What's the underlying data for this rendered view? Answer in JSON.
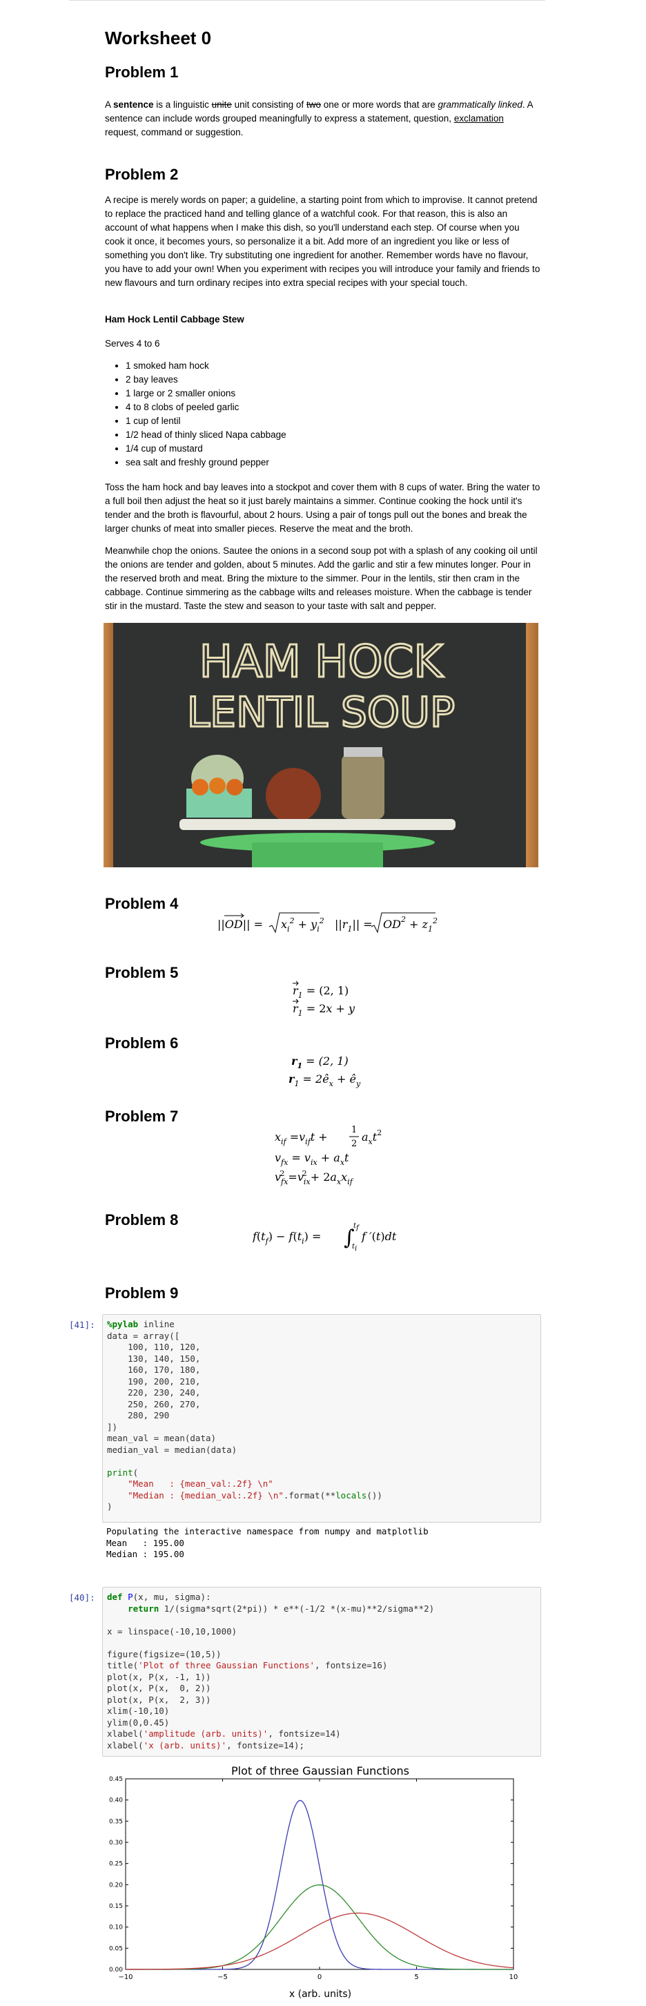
{
  "title": "Worksheet 0",
  "problem1": {
    "heading": "Problem 1",
    "sentence_word": "sentence",
    "strike1": "unite",
    "strike2": "two",
    "italic": "grammatically linked",
    "underline": "exclamation",
    "parts": [
      "A ",
      " is a linguistic ",
      " unit consisting of ",
      " one or more words that are ",
      ". A sentence can include words grouped meaningfully to express a statement, question, ",
      " request, command or suggestion."
    ]
  },
  "problem2": {
    "heading": "Problem 2",
    "intro": "A recipe is merely words on paper; a guideline, a starting point from which to improvise. It cannot pretend to replace the practiced hand and telling glance of a watchful cook. For that reason, this is also an account of what happens when I make this dish, so you'll understand each step. Of course when you cook it once, it becomes yours, so personalize it a bit. Add more of an ingredient you like or less of something you don't like. Try substituting one ingredient for another. Remember words have no flavour, you have to add your own! When you experiment with recipes you will introduce your family and friends to new flavours and turn ordinary recipes into extra special recipes with your special touch.",
    "recipe_title": "Ham Hock Lentil Cabbage Stew",
    "serves": "Serves 4 to 6",
    "ingredients": [
      "1 smoked ham hock",
      "2 bay leaves",
      "1 large or 2 smaller onions",
      "4 to 8 clobs of peeled garlic",
      "1 cup of lentil",
      "1/2 head of thinly sliced Napa cabbage",
      "1/4 cup of mustard",
      "sea salt and freshly ground pepper"
    ],
    "step1": "Toss the ham hock and bay leaves into a stockpot and cover them with 8 cups of water. Bring the water to a full boil then adjust the heat so it just barely maintains a simmer. Continue cooking the hock until it's tender and the broth is flavourful, about 2 hours. Using a pair of tongs pull out the bones and break the larger chunks of meat into smaller pieces. Reserve the meat and the broth.",
    "step2": "Meanwhile chop the onions. Sautee the onions in a second soup pot with a splash of any cooking oil until the onions are tender and golden, about 5 minutes. Add the garlic and stir a few minutes longer. Pour in the reserved broth and meat. Bring the mixture to the simmer. Pour in the lentils, stir then cram in the cabbage. Continue simmering as the cabbage wilts and releases moisture. When the cabbage is tender stir in the mustard. Taste the stew and season to your taste with salt and pepper.",
    "image_text_line1": "HAM HOCK",
    "image_text_line2": "LENTIL SOUP"
  },
  "problem4": {
    "heading": "Problem 4"
  },
  "problem5": {
    "heading": "Problem 5"
  },
  "problem6": {
    "heading": "Problem 6"
  },
  "problem7": {
    "heading": "Problem 7"
  },
  "problem8": {
    "heading": "Problem 8"
  },
  "problem9": {
    "heading": "Problem 9"
  },
  "cell41": {
    "prompt": "[41]:",
    "output": "Populating the interactive namespace from numpy and matplotlib\nMean   : 195.00\nMedian : 195.00"
  },
  "cell40": {
    "prompt": "[40]:"
  },
  "chart_data": {
    "type": "line",
    "title": "Plot of three Gaussian Functions",
    "xlabel": "x (arb. units)",
    "ylabel": "",
    "xlim": [
      -10,
      10
    ],
    "ylim": [
      0,
      0.45
    ],
    "xticks": [
      -10,
      -5,
      0,
      5,
      10
    ],
    "yticks": [
      0.0,
      0.05,
      0.1,
      0.15,
      0.2,
      0.25,
      0.3,
      0.35,
      0.4,
      0.45
    ],
    "series": [
      {
        "mu": -1,
        "sigma": 1,
        "color": "#3b3bb3"
      },
      {
        "mu": 0,
        "sigma": 2,
        "color": "#2e8b2e"
      },
      {
        "mu": 2,
        "sigma": 3,
        "color": "#c03a3a"
      }
    ]
  }
}
